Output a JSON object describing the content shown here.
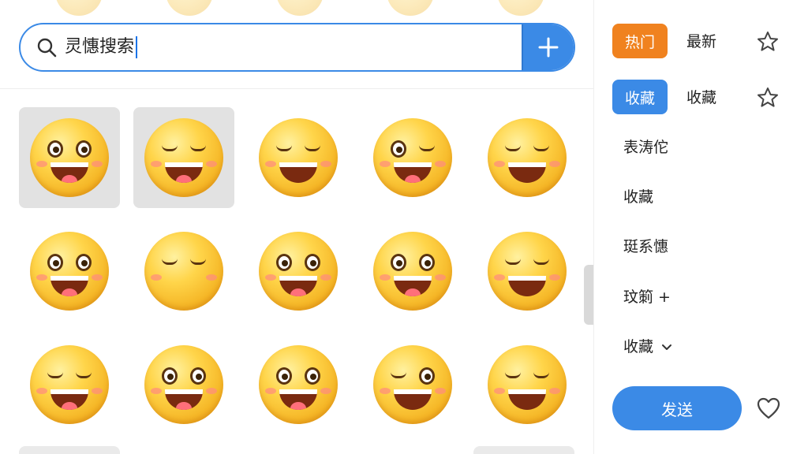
{
  "search": {
    "value": "灵憓搜索",
    "placeholder": ""
  },
  "panel": {
    "chip_hot": "热门",
    "label_latest": "最新",
    "chip_fav": "收藏",
    "label_fav": "收藏",
    "items": [
      "表涛佗",
      "收藏",
      "珽系憓",
      "玟箣 +",
      "收藏"
    ],
    "send_label": "发送"
  },
  "colors": {
    "accent": "#3b8ae6",
    "hot": "#f0821f"
  },
  "icons": [
    "search-icon",
    "plus-icon",
    "star-icon",
    "chevron-down-icon",
    "heart-icon"
  ]
}
